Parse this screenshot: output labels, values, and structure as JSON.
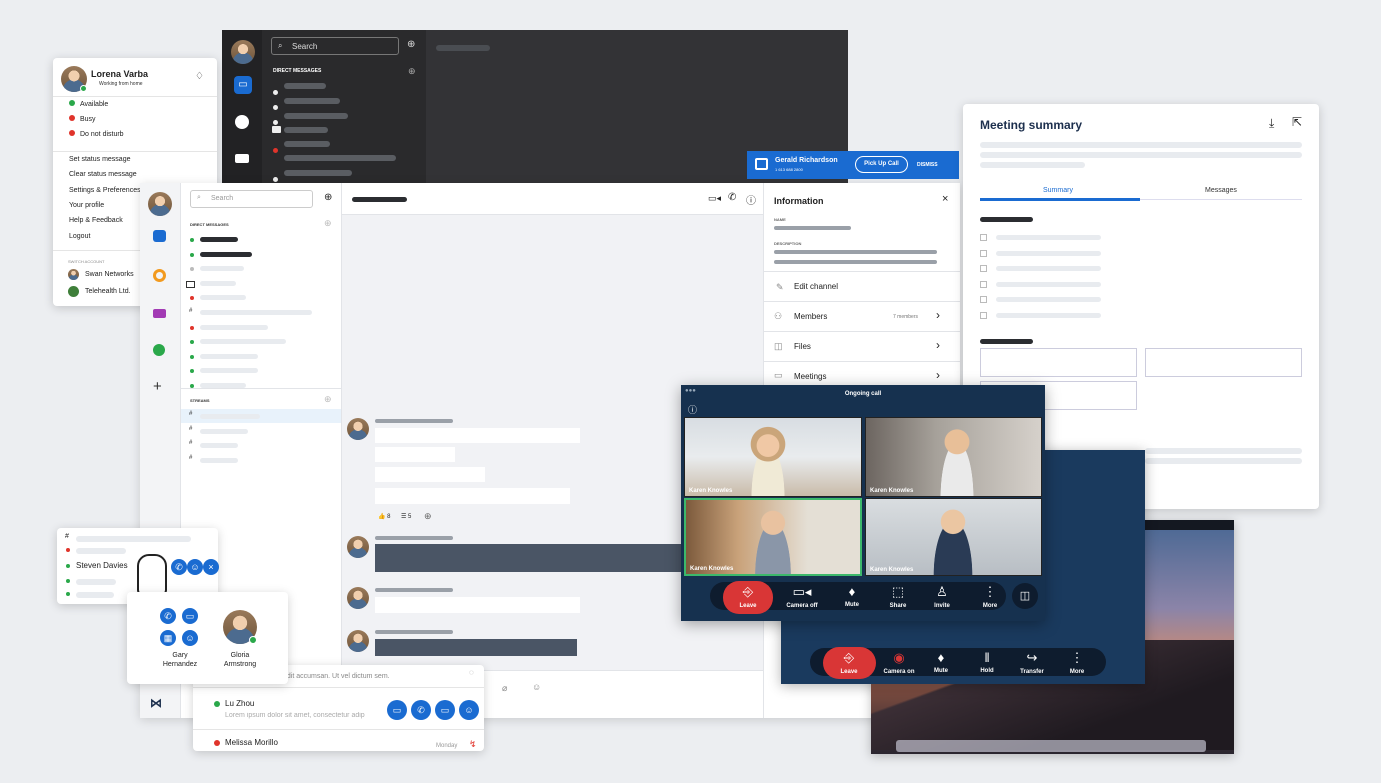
{
  "dark_app": {
    "search_placeholder": "Search",
    "section_direct": "DIRECT MESSAGES"
  },
  "status_card": {
    "user_name": "Lorena Varba",
    "user_status": "Working from home",
    "statuses": [
      {
        "label": "Available",
        "color": "#2aa84a"
      },
      {
        "label": "Busy",
        "color": "#e0342b"
      },
      {
        "label": "Do not disturb",
        "color": "#e0342b"
      }
    ],
    "menu": [
      "Set status message",
      "Clear status message",
      "Settings & Preferences",
      "Your profile",
      "Help & Feedback",
      "Logout"
    ],
    "switch_account_label": "SWITCH ACCOUNT",
    "accounts": [
      "Swan Networks",
      "Telehealth Ltd."
    ]
  },
  "main_app": {
    "search_placeholder": "Search",
    "section_direct": "DIRECT MESSAGES",
    "section_streams": "STREAMS",
    "reactions": [
      "8",
      "5"
    ]
  },
  "info_panel": {
    "title": "Information",
    "name_label": "NAME",
    "description_label": "DESCRIPTION",
    "edit_channel": "Edit channel",
    "members": "Members",
    "members_count": "7 members",
    "files": "Files",
    "meetings": "Meetings"
  },
  "incoming_call": {
    "caller": "Gerald Richardson",
    "number": "1 613 688 2800",
    "pickup": "Pick Up Call",
    "dismiss": "DISMISS"
  },
  "meeting_summary": {
    "title": "Meeting summary",
    "tabs": [
      "Summary",
      "Messages"
    ]
  },
  "ongoing_call": {
    "title": "Ongoing call",
    "participants": [
      "Karen Knowles",
      "Karen Knowles",
      "Karen Knowles",
      "Karen Knowles"
    ],
    "controls": [
      "Leave",
      "Camera off",
      "Mute",
      "Share",
      "Invite",
      "More"
    ]
  },
  "second_call": {
    "controls": [
      "Leave",
      "Camera on",
      "Mute",
      "Hold",
      "Transfer",
      "More"
    ]
  },
  "hover_list": {
    "contact": "Steven Davies"
  },
  "contact_card": {
    "contacts": [
      "Gary Hernandez",
      "Gloria Armstrong"
    ]
  },
  "chat_list": {
    "preview_top": "ndit accumsan. Ut vel dictum sem.",
    "items": [
      {
        "name": "Lu Zhou",
        "preview": "Lorem ipsum dolor sit amet, consectetur adip"
      },
      {
        "name": "Melissa Morillo",
        "time": "Monday"
      }
    ]
  },
  "colors": {
    "accent": "#1a6bd1",
    "dark_bg": "#2b2b2e",
    "call_bg": "#16314f",
    "leave_red": "#d93636"
  }
}
